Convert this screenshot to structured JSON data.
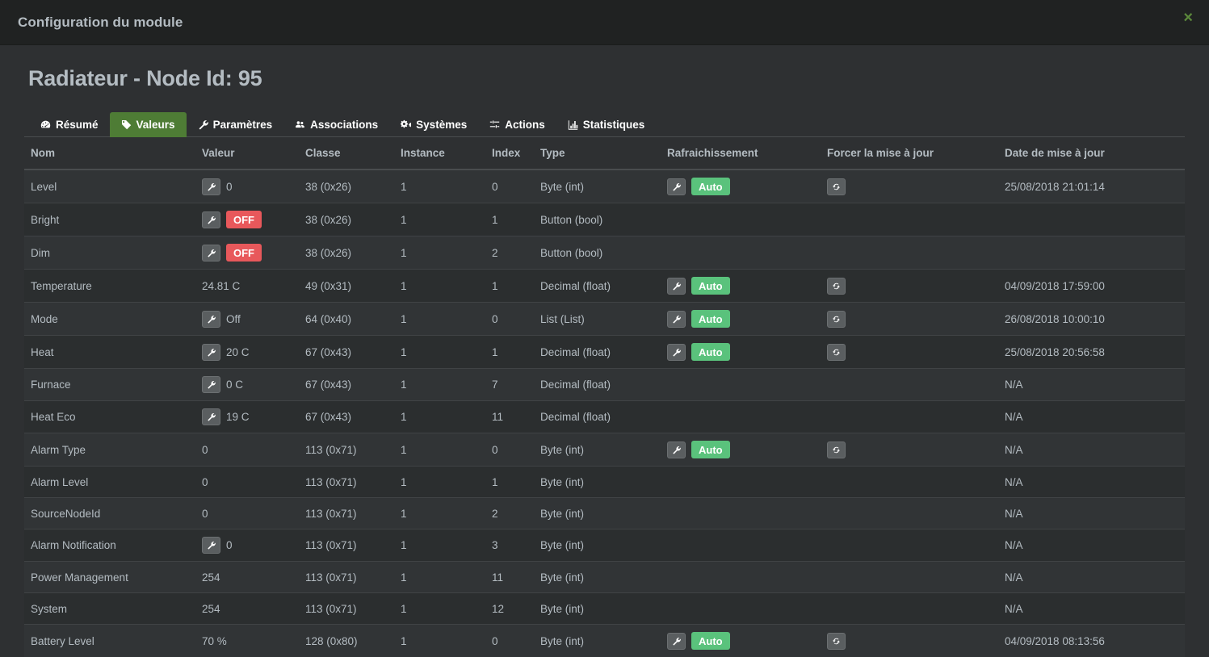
{
  "modal": {
    "title": "Configuration du module",
    "close_label": "×",
    "close_icon": "close-icon",
    "accent_green": "#4e7c35",
    "badge_red": "#e8585b",
    "badge_green": "#5ac27c"
  },
  "page": {
    "title": "Radiateur - Node Id: 95"
  },
  "tabs": [
    {
      "label": "Résumé",
      "icon": "dashboard-icon",
      "active": false
    },
    {
      "label": "Valeurs",
      "icon": "tag-icon",
      "active": true
    },
    {
      "label": "Paramètres",
      "icon": "wrench-icon",
      "active": false
    },
    {
      "label": "Associations",
      "icon": "users-icon",
      "active": false
    },
    {
      "label": "Systèmes",
      "icon": "cogs-icon",
      "active": false
    },
    {
      "label": "Actions",
      "icon": "sliders-icon",
      "active": false
    },
    {
      "label": "Statistiques",
      "icon": "bar-chart-icon",
      "active": false
    }
  ],
  "table": {
    "columns": [
      "Nom",
      "Valeur",
      "Classe",
      "Instance",
      "Index",
      "Type",
      "Rafraichissement",
      "Forcer la mise à jour",
      "Date de mise à jour"
    ],
    "rows": [
      {
        "nom": "Level",
        "valeur": "0",
        "valeur_wrench": true,
        "valeur_badge": null,
        "classe": "38 (0x26)",
        "instance": "1",
        "index": "0",
        "type": "Byte (int)",
        "refresh_wrench": true,
        "refresh_badge": "Auto",
        "force_update": true,
        "date": "25/08/2018 21:01:14"
      },
      {
        "nom": "Bright",
        "valeur": "",
        "valeur_wrench": true,
        "valeur_badge": "OFF",
        "classe": "38 (0x26)",
        "instance": "1",
        "index": "1",
        "type": "Button (bool)",
        "refresh_wrench": false,
        "refresh_badge": null,
        "force_update": false,
        "date": ""
      },
      {
        "nom": "Dim",
        "valeur": "",
        "valeur_wrench": true,
        "valeur_badge": "OFF",
        "classe": "38 (0x26)",
        "instance": "1",
        "index": "2",
        "type": "Button (bool)",
        "refresh_wrench": false,
        "refresh_badge": null,
        "force_update": false,
        "date": ""
      },
      {
        "nom": "Temperature",
        "valeur": "24.81 C",
        "valeur_wrench": false,
        "valeur_badge": null,
        "classe": "49 (0x31)",
        "instance": "1",
        "index": "1",
        "type": "Decimal (float)",
        "refresh_wrench": true,
        "refresh_badge": "Auto",
        "force_update": true,
        "date": "04/09/2018 17:59:00"
      },
      {
        "nom": "Mode",
        "valeur": "Off",
        "valeur_wrench": true,
        "valeur_badge": null,
        "classe": "64 (0x40)",
        "instance": "1",
        "index": "0",
        "type": "List (List)",
        "refresh_wrench": true,
        "refresh_badge": "Auto",
        "force_update": true,
        "date": "26/08/2018 10:00:10"
      },
      {
        "nom": "Heat",
        "valeur": "20 C",
        "valeur_wrench": true,
        "valeur_badge": null,
        "classe": "67 (0x43)",
        "instance": "1",
        "index": "1",
        "type": "Decimal (float)",
        "refresh_wrench": true,
        "refresh_badge": "Auto",
        "force_update": true,
        "date": "25/08/2018 20:56:58"
      },
      {
        "nom": "Furnace",
        "valeur": "0 C",
        "valeur_wrench": true,
        "valeur_badge": null,
        "classe": "67 (0x43)",
        "instance": "1",
        "index": "7",
        "type": "Decimal (float)",
        "refresh_wrench": false,
        "refresh_badge": null,
        "force_update": false,
        "date": "N/A"
      },
      {
        "nom": "Heat Eco",
        "valeur": "19 C",
        "valeur_wrench": true,
        "valeur_badge": null,
        "classe": "67 (0x43)",
        "instance": "1",
        "index": "11",
        "type": "Decimal (float)",
        "refresh_wrench": false,
        "refresh_badge": null,
        "force_update": false,
        "date": "N/A"
      },
      {
        "nom": "Alarm Type",
        "valeur": "0",
        "valeur_wrench": false,
        "valeur_badge": null,
        "classe": "113 (0x71)",
        "instance": "1",
        "index": "0",
        "type": "Byte (int)",
        "refresh_wrench": true,
        "refresh_badge": "Auto",
        "force_update": true,
        "date": "N/A"
      },
      {
        "nom": "Alarm Level",
        "valeur": "0",
        "valeur_wrench": false,
        "valeur_badge": null,
        "classe": "113 (0x71)",
        "instance": "1",
        "index": "1",
        "type": "Byte (int)",
        "refresh_wrench": false,
        "refresh_badge": null,
        "force_update": false,
        "date": "N/A"
      },
      {
        "nom": "SourceNodeId",
        "valeur": "0",
        "valeur_wrench": false,
        "valeur_badge": null,
        "classe": "113 (0x71)",
        "instance": "1",
        "index": "2",
        "type": "Byte (int)",
        "refresh_wrench": false,
        "refresh_badge": null,
        "force_update": false,
        "date": "N/A"
      },
      {
        "nom": "Alarm Notification",
        "valeur": "0",
        "valeur_wrench": true,
        "valeur_badge": null,
        "classe": "113 (0x71)",
        "instance": "1",
        "index": "3",
        "type": "Byte (int)",
        "refresh_wrench": false,
        "refresh_badge": null,
        "force_update": false,
        "date": "N/A"
      },
      {
        "nom": "Power Management",
        "valeur": "254",
        "valeur_wrench": false,
        "valeur_badge": null,
        "classe": "113 (0x71)",
        "instance": "1",
        "index": "11",
        "type": "Byte (int)",
        "refresh_wrench": false,
        "refresh_badge": null,
        "force_update": false,
        "date": "N/A"
      },
      {
        "nom": "System",
        "valeur": "254",
        "valeur_wrench": false,
        "valeur_badge": null,
        "classe": "113 (0x71)",
        "instance": "1",
        "index": "12",
        "type": "Byte (int)",
        "refresh_wrench": false,
        "refresh_badge": null,
        "force_update": false,
        "date": "N/A"
      },
      {
        "nom": "Battery Level",
        "valeur": "70 %",
        "valeur_wrench": false,
        "valeur_badge": null,
        "classe": "128 (0x80)",
        "instance": "1",
        "index": "0",
        "type": "Byte (int)",
        "refresh_wrench": true,
        "refresh_badge": "Auto",
        "force_update": true,
        "date": "04/09/2018 08:13:56"
      }
    ]
  }
}
